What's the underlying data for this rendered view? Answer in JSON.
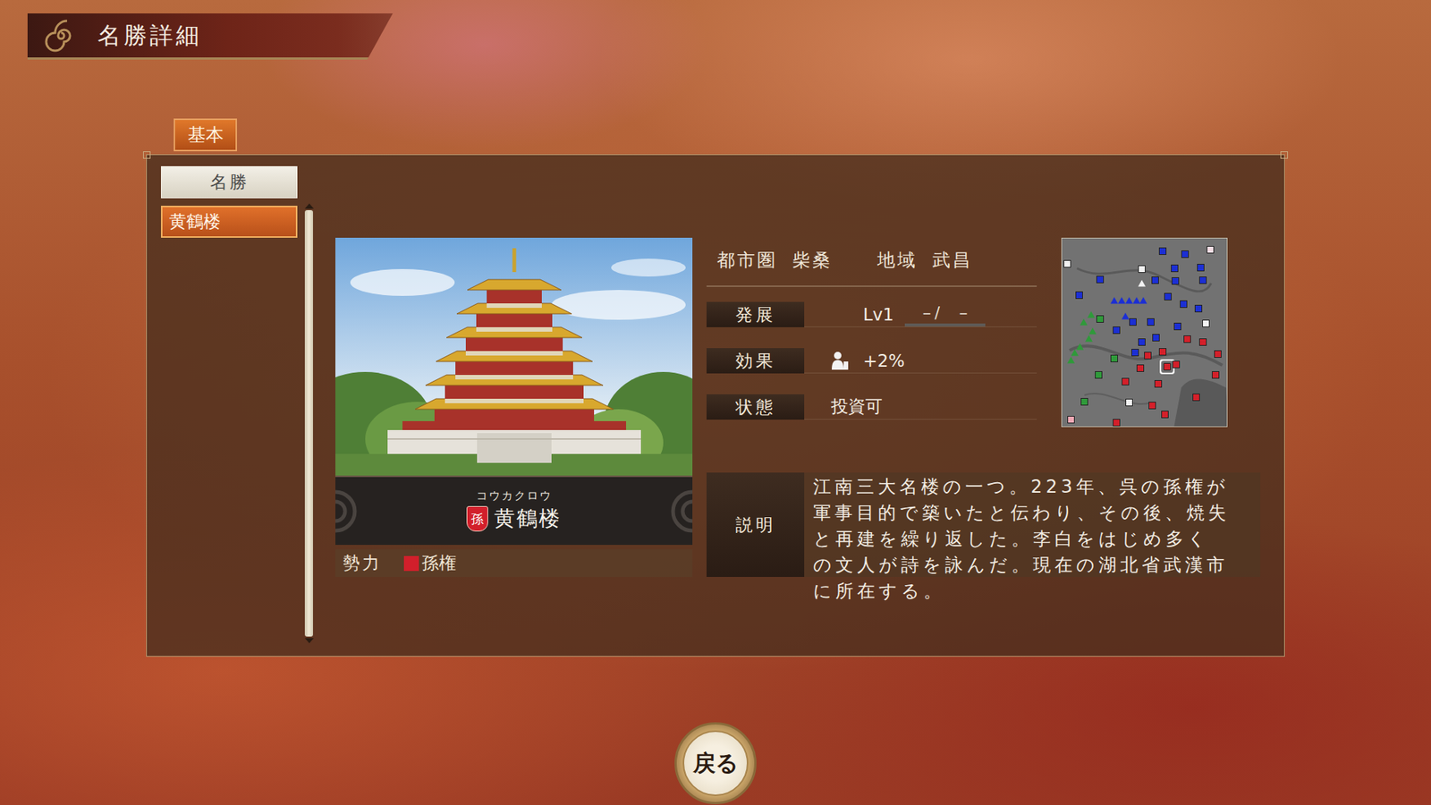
{
  "header": {
    "title": "名勝詳細"
  },
  "tabs": [
    {
      "label": "基本",
      "selected": true
    }
  ],
  "list": {
    "header": "名勝",
    "items": [
      {
        "label": "黄鶴楼",
        "selected": true
      }
    ]
  },
  "spot": {
    "reading": "コウカクロウ",
    "name": "黄鶴楼",
    "badge": "孫",
    "faction_label": "勢力",
    "faction": "孫権",
    "faction_color": "#d21f2b"
  },
  "info": {
    "area_label": "都市圏",
    "area": "柴桑",
    "region_label": "地域",
    "region": "武昌"
  },
  "rows": [
    {
      "label": "発展",
      "kind": "progress",
      "value": "Lv1",
      "extra": "－/　－",
      "level": 0
    },
    {
      "label": "効果",
      "kind": "effect",
      "value": "+2%"
    },
    {
      "label": "状態",
      "kind": "text",
      "value": "投資可"
    }
  ],
  "description": {
    "label": "説明",
    "text": "江南三大名楼の一つ。223年、呉の孫権が軍事目的で築いたと伝わり、その後、焼失と再建を繰り返した。李白をはじめ多くの文人が詩を詠んだ。現在の湖北省武漢市に所在する。"
  },
  "minimap": {
    "markers": [
      {
        "shape": "square",
        "color": "#1c2fd4",
        "x": 61,
        "y": 6.8,
        "selected": false
      },
      {
        "shape": "square",
        "color": "#1c2fd4",
        "x": 74.7,
        "y": 8.2,
        "selected": false
      },
      {
        "shape": "square",
        "color": "#1c2fd4",
        "x": 68.1,
        "y": 15.9,
        "selected": false
      },
      {
        "shape": "square",
        "color": "#1c2fd4",
        "x": 84.1,
        "y": 15.5,
        "selected": false
      },
      {
        "shape": "square",
        "color": "#1c2fd4",
        "x": 23.1,
        "y": 21.7,
        "selected": false
      },
      {
        "shape": "square",
        "color": "#1c2fd4",
        "x": 56.6,
        "y": 22.2,
        "selected": false
      },
      {
        "shape": "square",
        "color": "#1c2fd4",
        "x": 68.7,
        "y": 22.7,
        "selected": false
      },
      {
        "shape": "square",
        "color": "#1c2fd4",
        "x": 85.7,
        "y": 22.2,
        "selected": false
      },
      {
        "shape": "square",
        "color": "#1c2fd4",
        "x": 10.4,
        "y": 30,
        "selected": false
      },
      {
        "shape": "square",
        "color": "#1c2fd4",
        "x": 64.3,
        "y": 30.9,
        "selected": false
      },
      {
        "shape": "square",
        "color": "#1c2fd4",
        "x": 73.6,
        "y": 34.8,
        "selected": false
      },
      {
        "shape": "square",
        "color": "#1c2fd4",
        "x": 83,
        "y": 37.2,
        "selected": false
      },
      {
        "shape": "square",
        "color": "#1c2fd4",
        "x": 33,
        "y": 48.8,
        "selected": false
      },
      {
        "shape": "square",
        "color": "#1c2fd4",
        "x": 42.9,
        "y": 44.4,
        "selected": false
      },
      {
        "shape": "square",
        "color": "#1c2fd4",
        "x": 53.8,
        "y": 44.4,
        "selected": false
      },
      {
        "shape": "square",
        "color": "#1c2fd4",
        "x": 70.3,
        "y": 46.9,
        "selected": false
      },
      {
        "shape": "square",
        "color": "#1c2fd4",
        "x": 48.4,
        "y": 55.1,
        "selected": false
      },
      {
        "shape": "square",
        "color": "#1c2fd4",
        "x": 57.1,
        "y": 52.7,
        "selected": false
      },
      {
        "shape": "square",
        "color": "#1c2fd4",
        "x": 44.5,
        "y": 60.9,
        "selected": false
      },
      {
        "shape": "triangle",
        "color": "#1c2fd4",
        "x": 31.9,
        "y": 32.9,
        "selected": false
      },
      {
        "shape": "triangle",
        "color": "#1c2fd4",
        "x": 36.3,
        "y": 32.9,
        "selected": false
      },
      {
        "shape": "triangle",
        "color": "#1c2fd4",
        "x": 40.7,
        "y": 32.9,
        "selected": false
      },
      {
        "shape": "triangle",
        "color": "#1c2fd4",
        "x": 45.1,
        "y": 32.9,
        "selected": false
      },
      {
        "shape": "triangle",
        "color": "#1c2fd4",
        "x": 49.5,
        "y": 32.9,
        "selected": false
      },
      {
        "shape": "triangle",
        "color": "#1c2fd4",
        "x": 38.5,
        "y": 41.1,
        "selected": false
      },
      {
        "shape": "square",
        "color": "#f4dde4",
        "x": 90.1,
        "y": 5.8,
        "selected": false
      },
      {
        "shape": "square",
        "color": "#f2f2f2",
        "x": 3.3,
        "y": 13.5,
        "selected": false
      },
      {
        "shape": "square",
        "color": "#f2f2f2",
        "x": 48.4,
        "y": 16.4,
        "selected": false
      },
      {
        "shape": "square",
        "color": "#f2f2f2",
        "x": 87.4,
        "y": 45.4,
        "selected": false
      },
      {
        "shape": "square",
        "color": "#f2f2f2",
        "x": 40.7,
        "y": 87.4,
        "selected": false
      },
      {
        "shape": "triangle",
        "color": "#f2f2f2",
        "x": 48.4,
        "y": 23.7,
        "selected": false
      },
      {
        "shape": "triangle",
        "color": "#2f9a3a",
        "x": 17.6,
        "y": 40.6,
        "selected": false
      },
      {
        "shape": "triangle",
        "color": "#2f9a3a",
        "x": 13.2,
        "y": 44.4,
        "selected": false
      },
      {
        "shape": "triangle",
        "color": "#2f9a3a",
        "x": 18.7,
        "y": 49.3,
        "selected": false
      },
      {
        "shape": "triangle",
        "color": "#2f9a3a",
        "x": 16.5,
        "y": 53.1,
        "selected": false
      },
      {
        "shape": "triangle",
        "color": "#2f9a3a",
        "x": 11,
        "y": 57.5,
        "selected": false
      },
      {
        "shape": "triangle",
        "color": "#2f9a3a",
        "x": 7.7,
        "y": 60.9,
        "selected": false
      },
      {
        "shape": "triangle",
        "color": "#2f9a3a",
        "x": 5.5,
        "y": 64.7,
        "selected": false
      },
      {
        "shape": "square",
        "color": "#2f9a3a",
        "x": 23.1,
        "y": 43,
        "selected": false
      },
      {
        "shape": "square",
        "color": "#2f9a3a",
        "x": 31.9,
        "y": 63.8,
        "selected": false
      },
      {
        "shape": "square",
        "color": "#2f9a3a",
        "x": 22,
        "y": 72.5,
        "selected": false
      },
      {
        "shape": "square",
        "color": "#2f9a3a",
        "x": 13.7,
        "y": 87,
        "selected": false
      },
      {
        "shape": "square",
        "color": "#d4202a",
        "x": 75.8,
        "y": 53.6,
        "selected": false
      },
      {
        "shape": "square",
        "color": "#d4202a",
        "x": 85.7,
        "y": 55.1,
        "selected": false
      },
      {
        "shape": "square",
        "color": "#d4202a",
        "x": 94.5,
        "y": 61.4,
        "selected": false
      },
      {
        "shape": "square",
        "color": "#d4202a",
        "x": 61,
        "y": 60.4,
        "selected": false
      },
      {
        "shape": "square",
        "color": "#d4202a",
        "x": 52.2,
        "y": 62.3,
        "selected": false
      },
      {
        "shape": "square",
        "color": "#d4202a",
        "x": 63.7,
        "y": 68.1,
        "selected": true
      },
      {
        "shape": "square",
        "color": "#d4202a",
        "x": 69.2,
        "y": 67.1,
        "selected": false
      },
      {
        "shape": "square",
        "color": "#d4202a",
        "x": 47.3,
        "y": 69.1,
        "selected": false
      },
      {
        "shape": "square",
        "color": "#d4202a",
        "x": 38.5,
        "y": 76.3,
        "selected": false
      },
      {
        "shape": "square",
        "color": "#d4202a",
        "x": 58.2,
        "y": 77.3,
        "selected": false
      },
      {
        "shape": "square",
        "color": "#d4202a",
        "x": 93.4,
        "y": 72.5,
        "selected": false
      },
      {
        "shape": "square",
        "color": "#d4202a",
        "x": 81.3,
        "y": 84.5,
        "selected": false
      },
      {
        "shape": "square",
        "color": "#d4202a",
        "x": 54.9,
        "y": 88.9,
        "selected": false
      },
      {
        "shape": "square",
        "color": "#d4202a",
        "x": 62.6,
        "y": 93.7,
        "selected": false
      },
      {
        "shape": "square",
        "color": "#d4202a",
        "x": 33,
        "y": 98,
        "selected": false
      },
      {
        "shape": "square",
        "color": "#f0a8b4",
        "x": 5.5,
        "y": 96.6,
        "selected": false
      }
    ]
  },
  "buttons": [
    "戻る"
  ]
}
